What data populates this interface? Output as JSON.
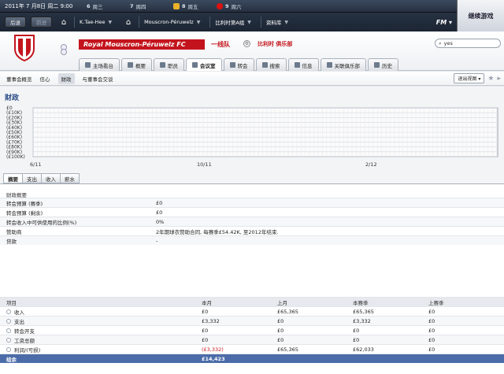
{
  "topbar": {
    "date": "2011年 7 月8日   周二 9:00",
    "days": [
      {
        "day": "6",
        "label": "周三"
      },
      {
        "day": "7",
        "label": "周四"
      },
      {
        "day": "8",
        "label": "周五"
      },
      {
        "day": "9",
        "label": "周六"
      }
    ],
    "continue_label": "继续游戏",
    "nav": {
      "back_label": "后退",
      "forward_label": "前进",
      "manager": "K.Tae-Hee",
      "club": "Mouscron-Péruwelz",
      "league": "比利时第A组",
      "data_menu": "资料库",
      "fm_label": "FM"
    }
  },
  "club": {
    "name": "Royal Mouscron-Péruwelz FC",
    "division": "一线队",
    "subtitle": "比利时 俱乐部",
    "search_value": "yes",
    "tabs": [
      {
        "label": "主场看台",
        "icon": "stadium-icon"
      },
      {
        "label": "概要",
        "icon": "overview-icon"
      },
      {
        "label": "职员",
        "icon": "staff-icon"
      },
      {
        "label": "会议室",
        "icon": "boardroom-icon"
      },
      {
        "label": "转会",
        "icon": "transfer-icon"
      },
      {
        "label": "搜索",
        "icon": "search-icon"
      },
      {
        "label": "信息",
        "icon": "news-icon"
      },
      {
        "label": "关联俱乐部",
        "icon": "link-icon"
      },
      {
        "label": "历史",
        "icon": "history-icon"
      }
    ],
    "active_tab": 3
  },
  "subnav": {
    "items": [
      "董事会概览",
      "信心",
      "财政",
      "与董事会交谈"
    ],
    "active": 2,
    "view_dropdown": "退出视图"
  },
  "finance": {
    "title": "财政",
    "subtabs": [
      "摘要",
      "支出",
      "收入",
      "薪水"
    ],
    "active_subtab": 0,
    "overview_title": "财政概要",
    "overview_rows": [
      {
        "label": "转会预算 (赛季)",
        "value": "£0"
      },
      {
        "label": "转会预算 (剩余)",
        "value": "£0"
      },
      {
        "label": "转会收入中可供使用的比例(%)",
        "value": "0%"
      },
      {
        "label": "赞助商",
        "value": "2年期球衣赞助合同, 每赛季£54.42K, 至2012年结束."
      },
      {
        "label": "贷款",
        "value": "-"
      }
    ],
    "table_header": [
      "项目",
      "本月",
      "上月",
      "本赛季",
      "上赛季"
    ],
    "table_rows": [
      {
        "label": "收入",
        "v": [
          "£0",
          "£65,365",
          "£65,365",
          "£0"
        ]
      },
      {
        "label": "支出",
        "v": [
          "£3,332",
          "£0",
          "£3,332",
          "£0"
        ]
      },
      {
        "label": "转会开支",
        "v": [
          "£0",
          "£0",
          "£0",
          "£0"
        ]
      },
      {
        "label": "工资总额",
        "v": [
          "£0",
          "£0",
          "£0",
          "£0"
        ]
      },
      {
        "label": "利润/(亏损)",
        "v": [
          "(£3,332)",
          "£65,365",
          "£62,033",
          "£0"
        ]
      }
    ],
    "balance": {
      "label": "结余",
      "value": "£14,423"
    }
  },
  "chart_data": {
    "type": "line",
    "title": "",
    "y_tick_labels": [
      "£0",
      "(£10K)",
      "(£20K)",
      "(£30K)",
      "(£40K)",
      "(£50K)",
      "(£60K)",
      "(£70K)",
      "(£80K)",
      "(£90K)",
      "(£100K)"
    ],
    "x_tick_labels": [
      "6/11",
      "10/11",
      "2/12"
    ],
    "ylim": [
      -100000,
      0
    ],
    "grid": true,
    "series": []
  },
  "colors": {
    "club_red": "#c3141d",
    "balance_row": "#4b6ca8",
    "title_blue": "#2a4d86"
  }
}
